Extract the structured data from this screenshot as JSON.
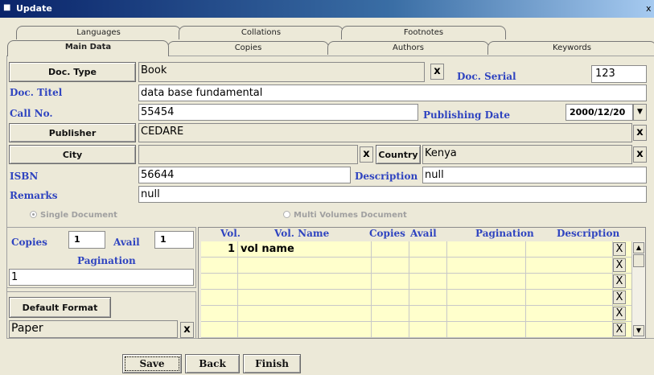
{
  "window": {
    "title": "Update",
    "icon": "app-icon",
    "close_glyph": "x"
  },
  "tabs_back": [
    "Languages",
    "Collations",
    "Footnotes"
  ],
  "tabs_front": [
    "Main Data",
    "Copies",
    "Authors",
    "Keywords"
  ],
  "active_tab": "Main Data",
  "form": {
    "doc_type_button": "Doc. Type",
    "doc_type_value": "Book",
    "doc_serial_label": "Doc. Serial",
    "doc_serial_value": "123",
    "doc_title_label": "Doc. Titel",
    "doc_title_value": "data base fundamental",
    "call_no_label": "Call No.",
    "call_no_value": "55454",
    "publishing_date_label": "Publishing Date",
    "publishing_date_value": "2000/12/20",
    "publisher_button": "Publisher",
    "publisher_value": "CEDARE",
    "city_button": "City",
    "city_value": "",
    "country_button": "Country",
    "country_value": "Kenya",
    "isbn_label": "ISBN",
    "isbn_value": "56644",
    "description_label": "Description",
    "description_value": "null",
    "remarks_label": "Remarks",
    "remarks_value": "null",
    "clear_glyph": "x"
  },
  "doc_mode": {
    "single_label": "Single Document",
    "multi_label": "Multi Volumes Document",
    "selected": "single"
  },
  "left_panel": {
    "copies_label": "Copies",
    "copies_value": "1",
    "avail_label": "Avail",
    "avail_value": "1",
    "pagination_label": "Pagination",
    "pagination_value": "1",
    "default_format_button": "Default Format",
    "format_value": "Paper"
  },
  "volumes": {
    "columns": [
      "Vol.",
      "Vol. Name",
      "Copies",
      "Avail",
      "Pagination",
      "Description"
    ],
    "rows": [
      {
        "vol": "1",
        "name": "vol name"
      }
    ],
    "row_delete_glyph": "X"
  },
  "buttons": {
    "save": "Save",
    "back": "Back",
    "finish": "Finish"
  }
}
